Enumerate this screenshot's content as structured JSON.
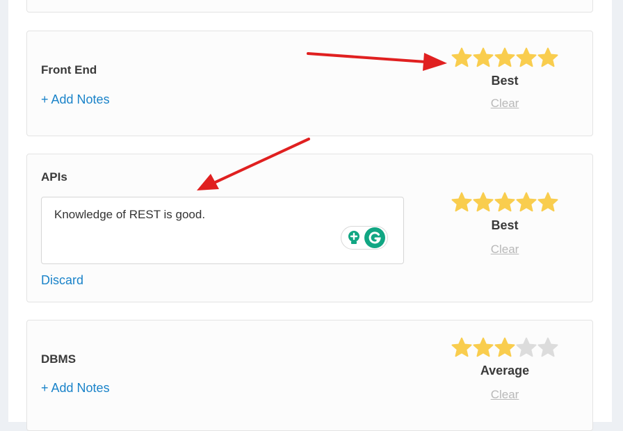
{
  "colors": {
    "star_filled": "#f9cd4e",
    "star_empty": "#dcdcdc",
    "link": "#1a83c9",
    "annotation_arrow": "#e02020",
    "grammarly_green": "#11a683"
  },
  "skills": [
    {
      "name": "Front End",
      "action": "+ Add Notes",
      "rating": 5,
      "max_rating": 5,
      "rating_label": "Best",
      "clear_label": "Clear"
    },
    {
      "name": "APIs",
      "notes_value": "Knowledge of REST is good.",
      "action": "Discard",
      "rating": 5,
      "max_rating": 5,
      "rating_label": "Best",
      "clear_label": "Clear",
      "extension_icons": [
        "grammarly-lightbulb-icon",
        "grammarly-g-icon"
      ]
    },
    {
      "name": "DBMS",
      "action": "+ Add Notes",
      "rating": 3,
      "max_rating": 5,
      "rating_label": "Average",
      "clear_label": "Clear"
    }
  ],
  "annotations": [
    "arrow-to-rating-stars",
    "arrow-to-notes-box"
  ]
}
